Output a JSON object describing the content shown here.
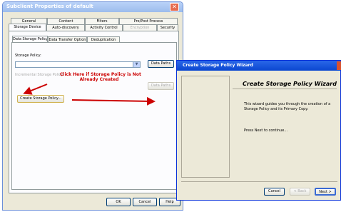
{
  "dialog1": {
    "title": "Subclient Properties of default",
    "tabs_row1": [
      "General",
      "Content",
      "Filters",
      "Pre/Post Process"
    ],
    "tabs_row2": [
      "Storage Device",
      "Auto-discovery",
      "Activity Control",
      "Encryption",
      "Security"
    ],
    "subtabs": [
      "Data Storage Policy",
      "Data Transfer Option",
      "Deduplication"
    ],
    "storage_policy_label": "Storage Policy:",
    "storage_policy_value": "",
    "data_paths_label": "Data Paths",
    "incremental_label": "Incremental Storage Policy:",
    "create_button_label": "Create Storage Policy...",
    "annotation_line1": "Click Here if Storage Policy is Not",
    "annotation_line2": "Already Created",
    "ok_label": "OK",
    "cancel_label": "Cancel",
    "help_label": "Help"
  },
  "dialog2": {
    "title": "Create Storage Policy Wizard",
    "heading": "Create Storage Policy Wizard",
    "description": "This wizard guides you through the creation of a Storage Policy and its Primary Copy.",
    "instruction": "Press Next to continue...",
    "cancel_label": "Cancel",
    "back_label": "< Back",
    "next_label": "Next >"
  },
  "colors": {
    "annotation_red": "#cc0000",
    "title_bar_blue": "#0a46d0",
    "inactive_title_blue": "#9cbcec"
  }
}
